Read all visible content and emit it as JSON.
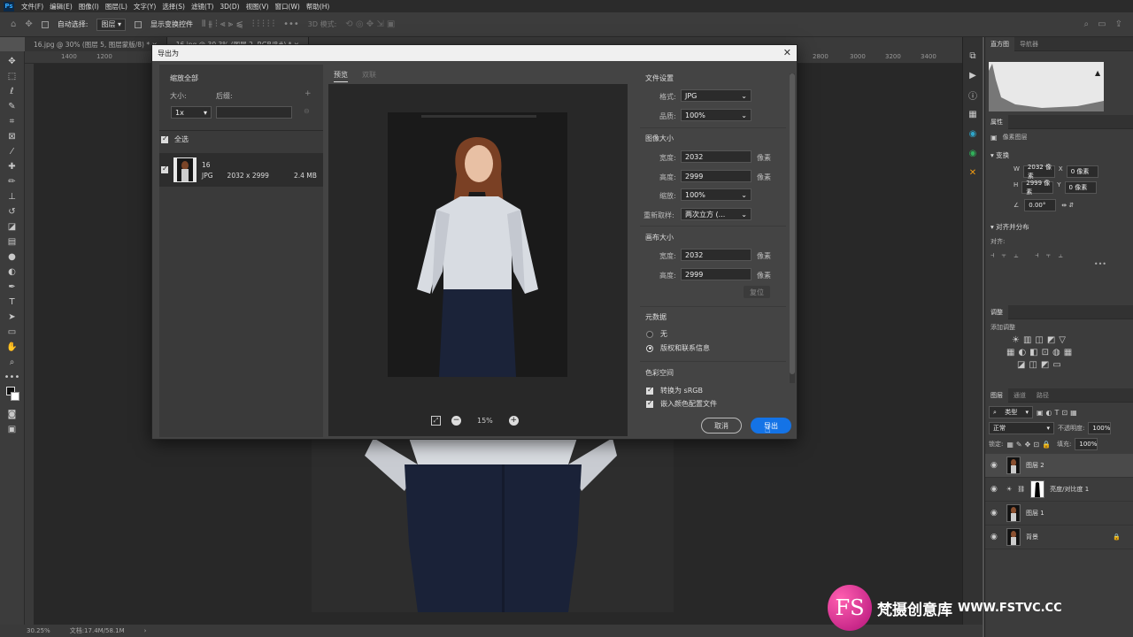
{
  "menubar": {
    "ps_label": "Ps",
    "items": [
      "文件(F)",
      "编辑(E)",
      "图像(I)",
      "图层(L)",
      "文字(Y)",
      "选择(S)",
      "滤镜(T)",
      "3D(D)",
      "视图(V)",
      "窗口(W)",
      "帮助(H)"
    ]
  },
  "options": {
    "auto_select_label": "自动选择:",
    "auto_select_value": "图层",
    "transform_label": "显示变换控件",
    "mode_label": "3D 模式:"
  },
  "doc_tabs": [
    "16.jpg @ 30% (图层 5, 图层蒙版/8) *",
    "16.jpg @ 30.3% (图层 2, RGB/8#) *"
  ],
  "ruler_top": [
    "1400",
    "1200",
    "2800",
    "3000",
    "3200",
    "3400"
  ],
  "status": {
    "zoom": "30.25%",
    "doc": "文档:17.4M/58.1M"
  },
  "dialog": {
    "title": "导出为",
    "scale_all": "缩放全部",
    "size_label": "大小:",
    "suffix_label": "后缀:",
    "scale_value": "1x",
    "select_all": "全选",
    "file": {
      "name": "16",
      "format": "JPG",
      "dims": "2032 x 2999",
      "size": "2.4 MB"
    },
    "preview_tab": "预览",
    "dual_tab": "双联",
    "zoom": "15%",
    "file_settings": "文件设置",
    "format_label": "格式:",
    "format_value": "JPG",
    "quality_label": "品质:",
    "quality_value": "100%",
    "image_size": "图像大小",
    "width_label": "宽度:",
    "width_value": "2032",
    "height_label": "高度:",
    "height_value": "2999",
    "unit": "像素",
    "scale_label": "缩放:",
    "scale_pct": "100%",
    "resample_label": "重新取样:",
    "resample_value": "两次立方 (...",
    "canvas_size": "画布大小",
    "canvas_width": "2032",
    "canvas_height": "2999",
    "reset": "复位",
    "metadata": "元数据",
    "meta_none": "无",
    "meta_copyright": "版权和联系信息",
    "color_space": "色彩空间",
    "convert_srgb": "转换为 sRGB",
    "embed_profile": "嵌入颜色配置文件",
    "cancel": "取消",
    "export": "导出"
  },
  "panels": {
    "histogram_tab": "直方图",
    "navigator_tab": "导航器",
    "properties_tab": "属性",
    "pixel_layer": "像素图层",
    "transform": "变换",
    "w_label": "W",
    "w_value": "2032 像素",
    "x_label": "X",
    "x_value": "0 像素",
    "h_label": "H",
    "h_value": "2999 像素",
    "y_label": "Y",
    "y_value": "0 像素",
    "angle": "0.00°",
    "align_dist": "对齐并分布",
    "align": "对齐:",
    "adjust_tab": "调整",
    "add_adjust": "添加调整",
    "layers_tab": "图层",
    "channels_tab": "通道",
    "paths_tab": "路径",
    "kind": "类型",
    "blend": "正常",
    "opacity_label": "不透明度:",
    "opacity": "100%",
    "lock_label": "锁定:",
    "fill_label": "填充:",
    "fill": "100%",
    "layers": [
      {
        "name": "图层 2"
      },
      {
        "name": "亮度/对比度 1"
      },
      {
        "name": "图层 1"
      },
      {
        "name": "背景"
      }
    ]
  },
  "watermark": {
    "logo": "FS",
    "text": "梵摄创意库",
    "url": "WWW.FSTVC.CC"
  }
}
